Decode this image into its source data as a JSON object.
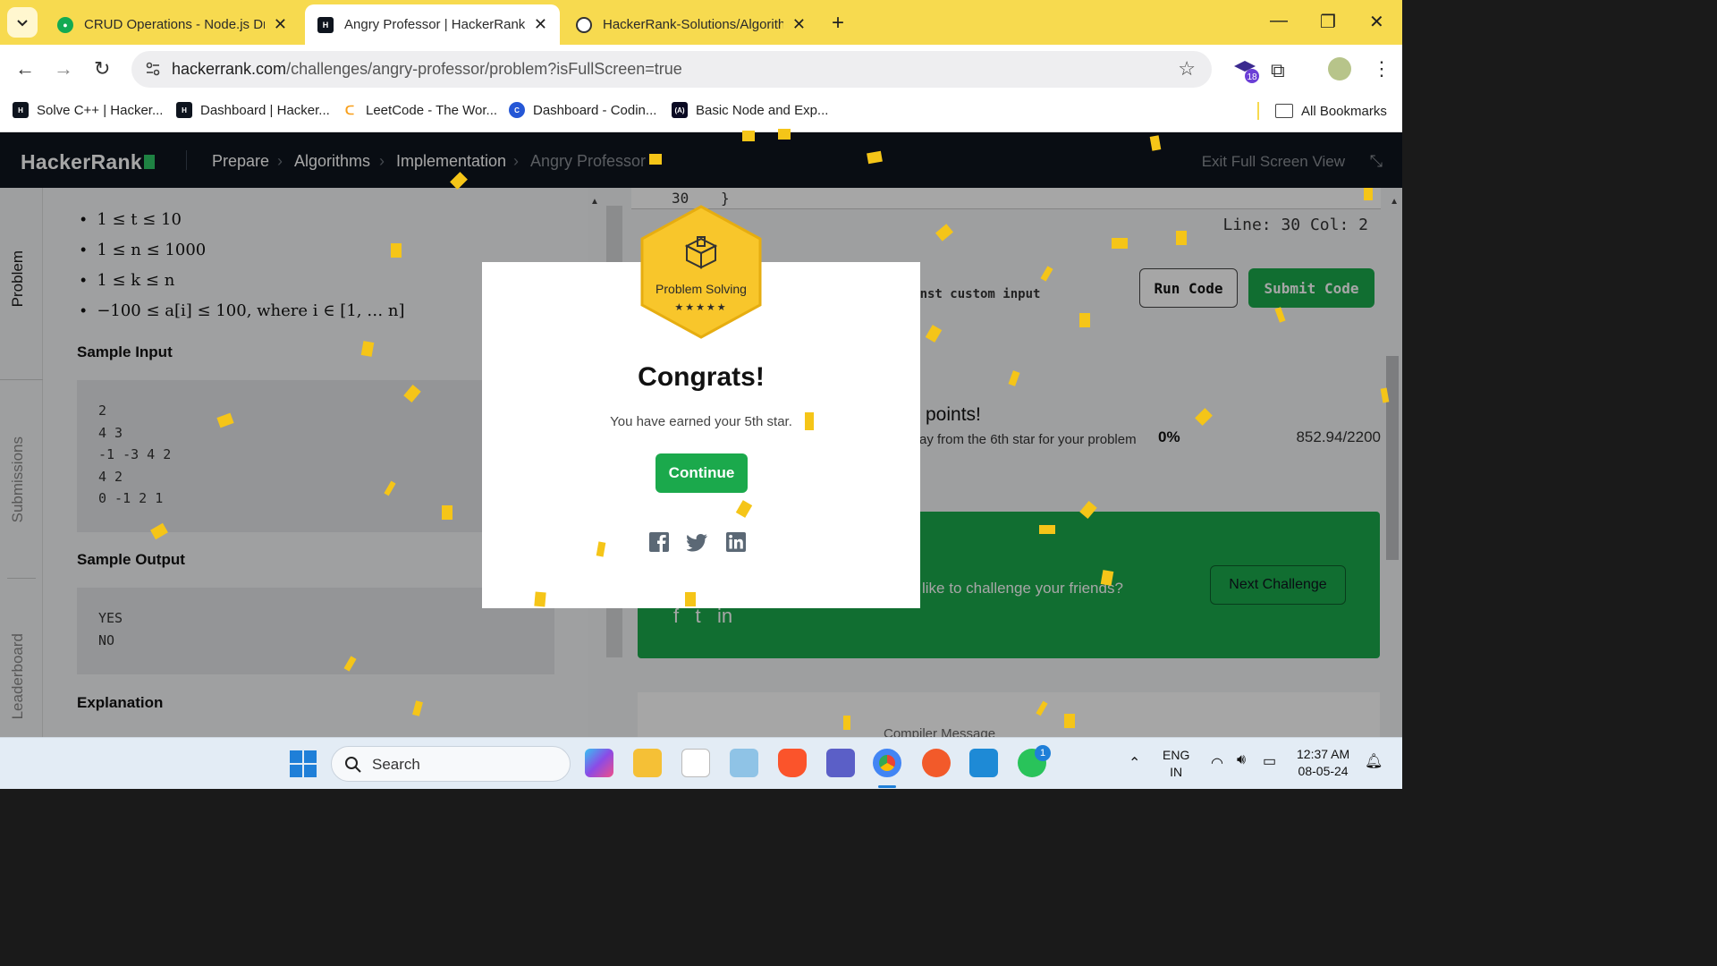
{
  "browser": {
    "tabs": [
      {
        "title": "CRUD Operations - Node.js Driv",
        "active": false
      },
      {
        "title": "Angry Professor | HackerRank",
        "active": true
      },
      {
        "title": "HackerRank-Solutions/Algorithm",
        "active": false
      }
    ],
    "url_host": "hackerrank.com",
    "url_path": "/challenges/angry-professor/problem?isFullScreen=true",
    "extension_badge": "18",
    "bookmarks": [
      "Solve C++ | Hacker...",
      "Dashboard | Hacker...",
      "LeetCode - The Wor...",
      "Dashboard - Codin...",
      "Basic Node and Exp..."
    ],
    "all_bookmarks": "All Bookmarks"
  },
  "hr": {
    "logo": "HackerRank",
    "breadcrumb": [
      "Prepare",
      "Algorithms",
      "Implementation",
      "Angry Professor"
    ],
    "exit_full_screen": "Exit Full Screen View",
    "side_tabs": [
      "Problem",
      "Submissions",
      "Leaderboard"
    ],
    "constraints": [
      "1 ≤ t ≤ 10",
      "1 ≤ n ≤ 1000",
      "1 ≤ k ≤ n",
      "−100 ≤ a[i] ≤ 100, where i ∈ [1, … n]"
    ],
    "sample_input_title": "Sample Input",
    "sample_input": "2\n4 3\n-1 -3 4 2\n4 2\n0 -1 2 1",
    "sample_output_title": "Sample Output",
    "sample_output": "YES\nNO",
    "explanation_title": "Explanation",
    "editor_line_number": "30",
    "editor_line_text": "}",
    "line_col": "Line: 30 Col: 2",
    "custom_input_hint": "t against custom input",
    "run_code": "Run Code",
    "submit_code": "Submit Code",
    "points_title": "points!",
    "points_sub": "ay from the 6th star for your problem",
    "points_pct": "0%",
    "points_score": "852.94/2200",
    "challenge_text": "like to challenge your friends?",
    "next_challenge": "Next Challenge",
    "compiler_message": "Compiler Message"
  },
  "modal": {
    "badge_label": "Problem Solving",
    "badge_stars": "★★★★★",
    "title": "Congrats!",
    "message": "You have earned your 5th star.",
    "continue": "Continue"
  },
  "taskbar": {
    "search": "Search",
    "lang": "ENG",
    "region": "IN",
    "time": "12:37 AM",
    "date": "08-05-24",
    "teams_badge": "1"
  },
  "colors": {
    "tabbar": "#f7da4f",
    "hr_green": "#1ba94c",
    "confetti": "#f5c518"
  }
}
